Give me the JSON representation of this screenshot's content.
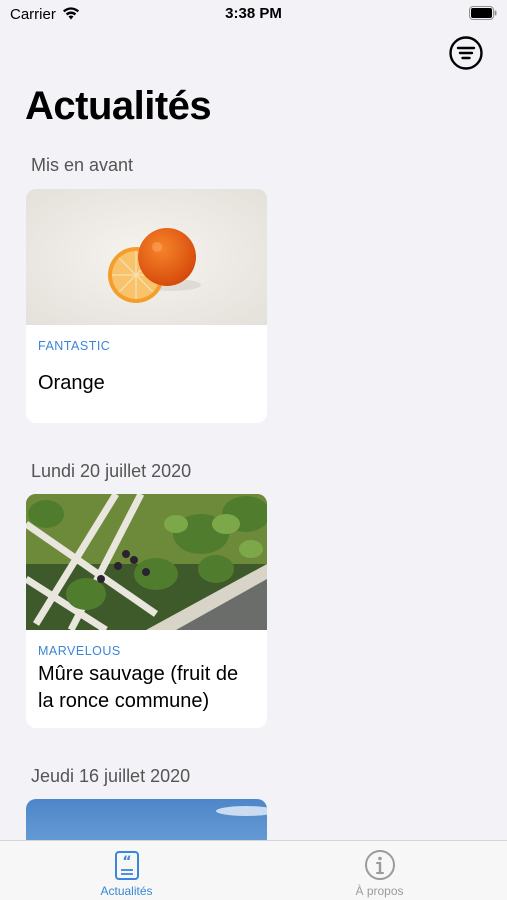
{
  "status_bar": {
    "carrier": "Carrier",
    "time": "3:38 PM"
  },
  "page": {
    "title": "Actualités"
  },
  "sections": [
    {
      "header": "Mis en avant",
      "card": {
        "tag": "FANTASTIC",
        "title": "Orange",
        "image": "orange-photo"
      }
    },
    {
      "header": "Lundi 20 juillet 2020",
      "card": {
        "tag": "MARVELOUS",
        "title": "Mûre sauvage (fruit de la ronce commune)",
        "image": "blackberry-photo"
      }
    },
    {
      "header": "Jeudi 16 juillet 2020",
      "card": {
        "tag": "",
        "title": "",
        "image": "sky-photo"
      }
    }
  ],
  "tab_bar": {
    "tabs": [
      {
        "label": "Actualités",
        "icon": "news-icon",
        "active": true
      },
      {
        "label": "À propos",
        "icon": "info-icon",
        "active": false
      }
    ]
  },
  "colors": {
    "accent": "#3a86d8",
    "tag": "#3a86d8",
    "inactive": "#9b9b9b",
    "background": "#f2f2f7"
  }
}
